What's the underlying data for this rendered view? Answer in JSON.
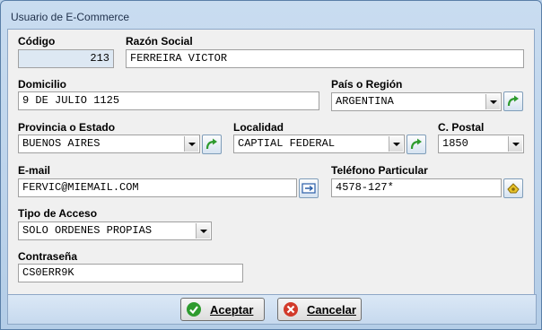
{
  "window": {
    "title": "Usuario de E-Commerce"
  },
  "fields": {
    "codigo": {
      "label": "Código",
      "value": "213"
    },
    "razon_social": {
      "label": "Razón Social",
      "value": "FERREIRA VICTOR"
    },
    "domicilio": {
      "label": "Domicilio",
      "value": "9 DE JULIO 1125"
    },
    "pais": {
      "label": "País o Región",
      "value": "ARGENTINA"
    },
    "provincia": {
      "label": "Provincia o Estado",
      "value": "BUENOS AIRES"
    },
    "localidad": {
      "label": "Localidad",
      "value": "CAPTIAL FEDERAL"
    },
    "cpostal": {
      "label": "C. Postal",
      "value": "1850"
    },
    "email": {
      "label": "E-mail",
      "value": "FERVIC@MIEMAIL.COM"
    },
    "telefono": {
      "label": "Teléfono Particular",
      "value": "4578-127*"
    },
    "tipo_acceso": {
      "label": "Tipo de Acceso",
      "value": "SOLO ORDENES PROPIAS"
    },
    "contrasena": {
      "label": "Contraseña",
      "value": "CS0ERR9K"
    }
  },
  "buttons": {
    "accept": "Aceptar",
    "cancel": "Cancelar"
  },
  "icons": {
    "refresh": "green-arrow-refresh-icon",
    "email_action": "email-send-icon",
    "phone_action": "phone-icon",
    "ok": "green-check-icon",
    "cancel": "red-x-icon"
  },
  "colors": {
    "accent_green": "#2e9b2e",
    "cancel_red": "#d23a2a",
    "disabled_field": "#dde8f3"
  }
}
